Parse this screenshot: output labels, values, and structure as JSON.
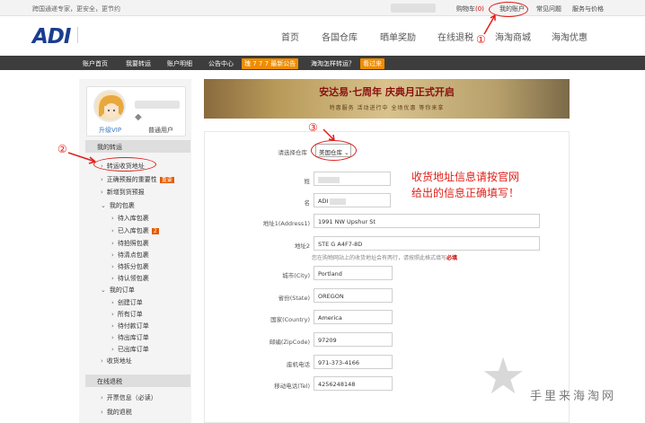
{
  "topbar": {
    "slogan": "跨国通递专家，更安全，更节约",
    "cart_label": "购物车",
    "cart_count": "(0)",
    "my_account": "我的账户",
    "faq": "常见问题",
    "service_price": "服务与价格"
  },
  "header": {
    "logo": "ADI",
    "nav": [
      "首页",
      "各国仓库",
      "晒单奖励",
      "在线退税",
      "海淘商城",
      "海淘优惠"
    ]
  },
  "account_bar": {
    "items": [
      "账户首页",
      "我要转运",
      "账户明细",
      "公告中心"
    ],
    "announcement_badge": "瑰 7 7 7 最新公告",
    "howto": "海淘怎样转运？",
    "howto_badge": "看过来"
  },
  "sidebar": {
    "upgrade_vip": "升级VIP",
    "user_level": "普通用户",
    "section_transfer": "我的转运",
    "transfer_items": [
      {
        "label": "转运收货地址"
      },
      {
        "label": "正确预报的重要性",
        "tag": "重要"
      },
      {
        "label": "新增到货预报"
      },
      {
        "label": "我的包裹"
      }
    ],
    "package_items": [
      {
        "label": "待入库包裹"
      },
      {
        "label": "已入库包裹",
        "tag": "2"
      },
      {
        "label": "待拍照包裹"
      },
      {
        "label": "待清点包裹"
      },
      {
        "label": "待拆分包裹"
      },
      {
        "label": "待认领包裹"
      }
    ],
    "orders_label": "我的订单",
    "order_items": [
      {
        "label": "创建订单"
      },
      {
        "label": "所有订单"
      },
      {
        "label": "待付款订单"
      },
      {
        "label": "待出库订单"
      },
      {
        "label": "已出库订单"
      }
    ],
    "receive_address": "收货地址",
    "section_tax": "在线退税",
    "tax_items": [
      {
        "label": "开票信息（必读）"
      },
      {
        "label": "我的退税"
      }
    ]
  },
  "banner": {
    "title": "安达易·七周年 庆典月正式开启",
    "subtitle": "特惠服务 活动进行中 全场优惠 等你来拿"
  },
  "form": {
    "warehouse_label": "请选择仓库",
    "warehouse_value": "美国仓库",
    "fields": {
      "last_name_label": "姓",
      "first_name_label": "名",
      "first_name_value": "ADI",
      "address1_label": "地址1(Address1)",
      "address1_value": "1991 NW Upshur St",
      "address2_label": "地址2",
      "address2_value": "STE G A4F7-8D",
      "note": "您在购物网站上的收货地址会有两行，请按照此格式填写",
      "note_emph": "必填",
      "city_label": "城市(City)",
      "city_value": "Portland",
      "state_label": "省份(State)",
      "state_value": "OREGON",
      "country_label": "国家(Country)",
      "country_value": "America",
      "zip_label": "邮编(ZipCode)",
      "zip_value": "97209",
      "phone_label": "座机电话",
      "phone_value": "971-373-4166",
      "mobile_label": "移动电话(Tel)",
      "mobile_value": "4256248148"
    }
  },
  "annotations": {
    "one": "①",
    "two": "②",
    "three": "③",
    "tip_line1": "收货地址信息请按官网",
    "tip_line2": "给出的信息正确填写！",
    "watermark": "手里来海淘网"
  },
  "colors": {
    "accent_red": "#e0201a",
    "logo_blue": "#1a3d8f",
    "dark_bar": "#3d3d3d",
    "badge_orange": "#f08c00"
  }
}
